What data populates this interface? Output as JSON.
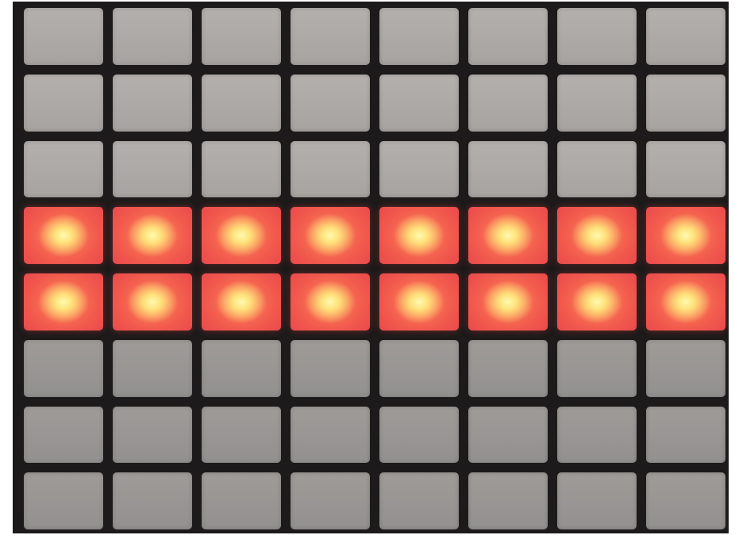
{
  "device": {
    "columns": 8,
    "rows": 8,
    "colors": {
      "pad_off": "#aeaba8",
      "pad_lit_center": "#fff3a0",
      "pad_lit_edge": "#ef4f4b",
      "frame": "#1c1a1a"
    },
    "lit_rows": [
      4,
      5
    ],
    "pads": [
      {
        "row": 1,
        "col": 1,
        "state": "off"
      },
      {
        "row": 1,
        "col": 2,
        "state": "off"
      },
      {
        "row": 1,
        "col": 3,
        "state": "off"
      },
      {
        "row": 1,
        "col": 4,
        "state": "off"
      },
      {
        "row": 1,
        "col": 5,
        "state": "off"
      },
      {
        "row": 1,
        "col": 6,
        "state": "off"
      },
      {
        "row": 1,
        "col": 7,
        "state": "off"
      },
      {
        "row": 1,
        "col": 8,
        "state": "off"
      },
      {
        "row": 2,
        "col": 1,
        "state": "off"
      },
      {
        "row": 2,
        "col": 2,
        "state": "off"
      },
      {
        "row": 2,
        "col": 3,
        "state": "off"
      },
      {
        "row": 2,
        "col": 4,
        "state": "off"
      },
      {
        "row": 2,
        "col": 5,
        "state": "off"
      },
      {
        "row": 2,
        "col": 6,
        "state": "off"
      },
      {
        "row": 2,
        "col": 7,
        "state": "off"
      },
      {
        "row": 2,
        "col": 8,
        "state": "off"
      },
      {
        "row": 3,
        "col": 1,
        "state": "off"
      },
      {
        "row": 3,
        "col": 2,
        "state": "off"
      },
      {
        "row": 3,
        "col": 3,
        "state": "off"
      },
      {
        "row": 3,
        "col": 4,
        "state": "off"
      },
      {
        "row": 3,
        "col": 5,
        "state": "off"
      },
      {
        "row": 3,
        "col": 6,
        "state": "off"
      },
      {
        "row": 3,
        "col": 7,
        "state": "off"
      },
      {
        "row": 3,
        "col": 8,
        "state": "off"
      },
      {
        "row": 4,
        "col": 1,
        "state": "lit"
      },
      {
        "row": 4,
        "col": 2,
        "state": "lit"
      },
      {
        "row": 4,
        "col": 3,
        "state": "lit"
      },
      {
        "row": 4,
        "col": 4,
        "state": "lit"
      },
      {
        "row": 4,
        "col": 5,
        "state": "lit"
      },
      {
        "row": 4,
        "col": 6,
        "state": "lit"
      },
      {
        "row": 4,
        "col": 7,
        "state": "lit"
      },
      {
        "row": 4,
        "col": 8,
        "state": "lit"
      },
      {
        "row": 5,
        "col": 1,
        "state": "lit"
      },
      {
        "row": 5,
        "col": 2,
        "state": "lit"
      },
      {
        "row": 5,
        "col": 3,
        "state": "lit"
      },
      {
        "row": 5,
        "col": 4,
        "state": "lit"
      },
      {
        "row": 5,
        "col": 5,
        "state": "lit"
      },
      {
        "row": 5,
        "col": 6,
        "state": "lit"
      },
      {
        "row": 5,
        "col": 7,
        "state": "lit"
      },
      {
        "row": 5,
        "col": 8,
        "state": "lit"
      },
      {
        "row": 6,
        "col": 1,
        "state": "off"
      },
      {
        "row": 6,
        "col": 2,
        "state": "off"
      },
      {
        "row": 6,
        "col": 3,
        "state": "off"
      },
      {
        "row": 6,
        "col": 4,
        "state": "off"
      },
      {
        "row": 6,
        "col": 5,
        "state": "off"
      },
      {
        "row": 6,
        "col": 6,
        "state": "off"
      },
      {
        "row": 6,
        "col": 7,
        "state": "off"
      },
      {
        "row": 6,
        "col": 8,
        "state": "off"
      },
      {
        "row": 7,
        "col": 1,
        "state": "off"
      },
      {
        "row": 7,
        "col": 2,
        "state": "off"
      },
      {
        "row": 7,
        "col": 3,
        "state": "off"
      },
      {
        "row": 7,
        "col": 4,
        "state": "off"
      },
      {
        "row": 7,
        "col": 5,
        "state": "off"
      },
      {
        "row": 7,
        "col": 6,
        "state": "off"
      },
      {
        "row": 7,
        "col": 7,
        "state": "off"
      },
      {
        "row": 7,
        "col": 8,
        "state": "off"
      },
      {
        "row": 8,
        "col": 1,
        "state": "off"
      },
      {
        "row": 8,
        "col": 2,
        "state": "off"
      },
      {
        "row": 8,
        "col": 3,
        "state": "off"
      },
      {
        "row": 8,
        "col": 4,
        "state": "off"
      },
      {
        "row": 8,
        "col": 5,
        "state": "off"
      },
      {
        "row": 8,
        "col": 6,
        "state": "off"
      },
      {
        "row": 8,
        "col": 7,
        "state": "off"
      },
      {
        "row": 8,
        "col": 8,
        "state": "off"
      }
    ]
  }
}
